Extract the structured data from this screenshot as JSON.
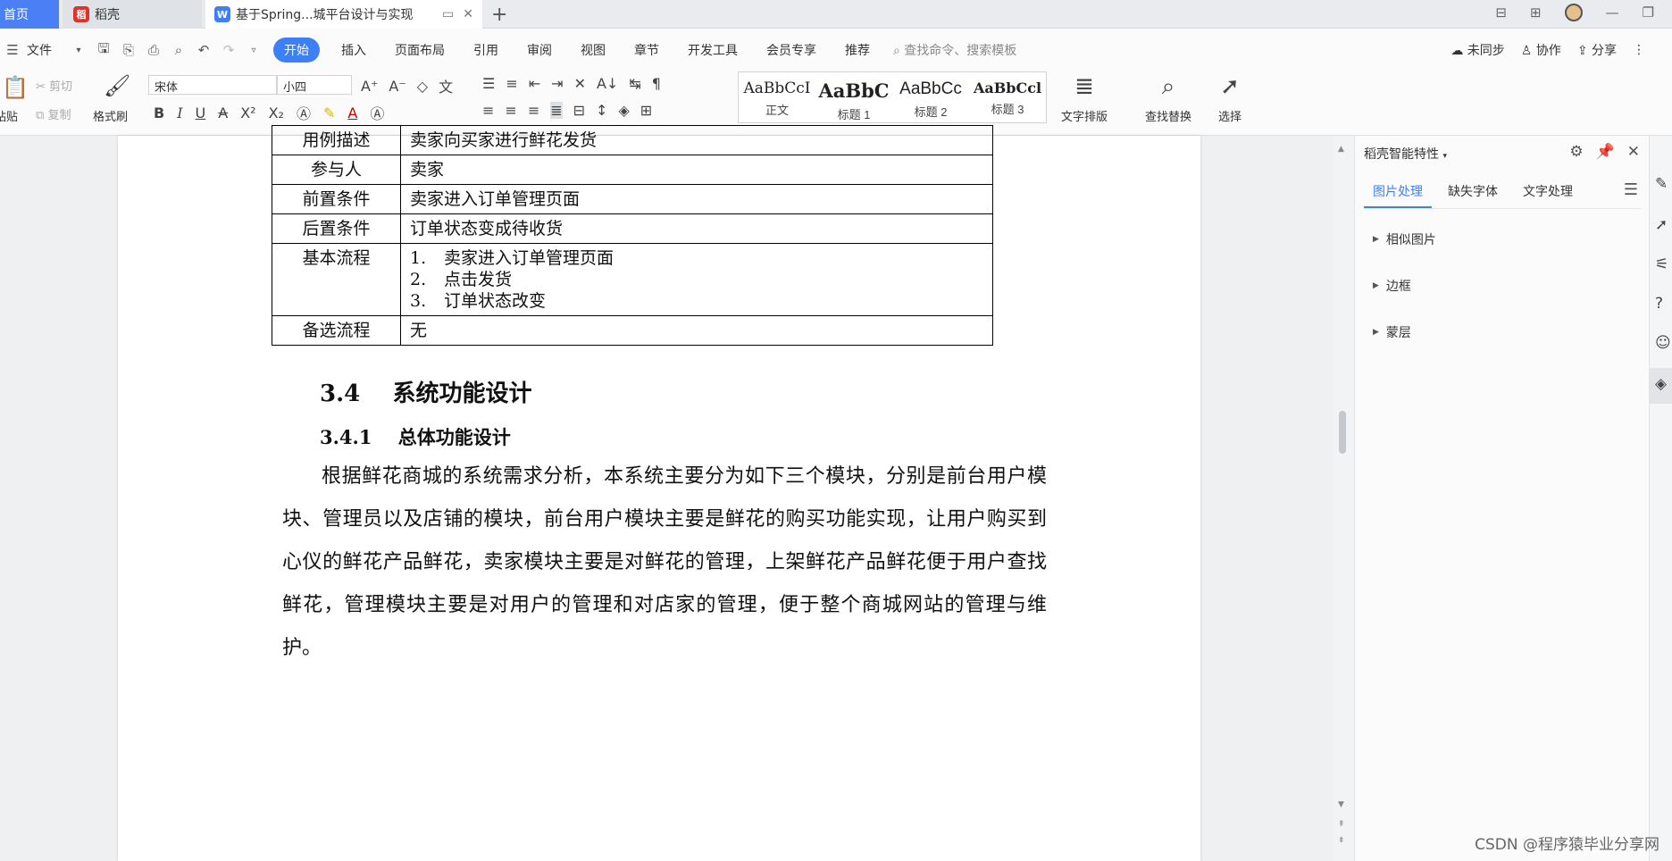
{
  "tabs": {
    "home": "首页",
    "daoke": "稻壳",
    "doc": "基于Spring...城平台设计与实现"
  },
  "menubar": {
    "file": "文件",
    "items": [
      "开始",
      "插入",
      "页面布局",
      "引用",
      "审阅",
      "视图",
      "章节",
      "开发工具",
      "会员专享",
      "推荐"
    ],
    "search_placeholder": "查找命令、搜索模板",
    "sync": "未同步",
    "collab": "协作",
    "share": "分享"
  },
  "ribbon": {
    "paste": "粘贴",
    "cut": "剪切",
    "copy": "复制",
    "format_painter": "格式刷",
    "font_name": "宋体",
    "font_size": "小四",
    "styles": [
      {
        "sample": "AaBbCcI",
        "name": "正文"
      },
      {
        "sample": "AaBbC",
        "name": "标题 1"
      },
      {
        "sample": "AaBbCc",
        "name": "标题 2"
      },
      {
        "sample": "AaBbCcl",
        "name": "标题 3"
      }
    ],
    "text_layout": "文字排版",
    "find_replace": "查找替换",
    "select": "选择"
  },
  "document": {
    "table": [
      {
        "label": "用例描述",
        "value": "卖家向买家进行鲜花发货"
      },
      {
        "label": "参与人",
        "value": "卖家"
      },
      {
        "label": "前置条件",
        "value": "卖家进入订单管理页面"
      },
      {
        "label": "后置条件",
        "value": "订单状态变成待收货"
      },
      {
        "label": "基本流程",
        "steps": [
          "卖家进入订单管理页面",
          "点击发货",
          "订单状态改变"
        ]
      },
      {
        "label": "备选流程",
        "value": "无"
      }
    ],
    "heading2": "3.4    系统功能设计",
    "heading3": "3.4.1    总体功能设计",
    "paragraph": "根据鲜花商城的系统需求分析，本系统主要分为如下三个模块，分别是前台用户模块、管理员以及店铺的模块，前台用户模块主要是鲜花的购买功能实现，让用户购买到心仪的鲜花产品鲜花，卖家模块主要是对鲜花的管理，上架鲜花产品鲜花便于用户查找鲜花，管理模块主要是对用户的管理和对店家的管理，便于整个商城网站的管理与维护。"
  },
  "panel": {
    "title": "稻壳智能特性",
    "tabs": [
      "图片处理",
      "缺失字体",
      "文字处理"
    ],
    "active_tab": "图片处理",
    "items": [
      "相似图片",
      "边框",
      "蒙层"
    ]
  },
  "watermark": "CSDN @程序猿毕业分享网"
}
